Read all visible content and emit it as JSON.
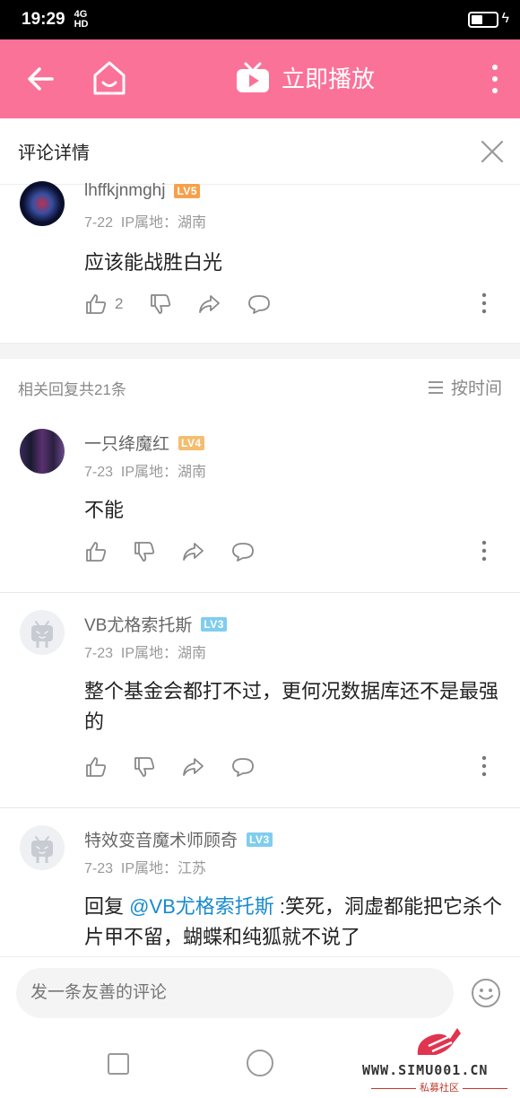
{
  "status_bar": {
    "time": "19:29",
    "network": "4G",
    "hd": "HD"
  },
  "app_bar": {
    "play_label": "立即播放"
  },
  "header": {
    "title": "评论详情"
  },
  "main_comment": {
    "user": "lhffkjnmghj",
    "level": "LV5",
    "level_color": "#f7a04a",
    "date": "7-22",
    "ip": "IP属地：湖南",
    "content": "应该能战胜白光",
    "likes": "2"
  },
  "replies_header": {
    "count_label": "相关回复共21条",
    "sort_label": "按时间"
  },
  "replies": [
    {
      "user": "一只绛魔红",
      "level": "LV4",
      "level_color": "#f5bd70",
      "date": "7-23",
      "ip": "IP属地：湖南",
      "content": "不能"
    },
    {
      "user": "VB尤格索托斯",
      "level": "LV3",
      "level_color": "#7fcdef",
      "date": "7-23",
      "ip": "IP属地：湖南",
      "content": "整个基金会都打不过，更何况数据库还不是最强的"
    },
    {
      "user": "特效变音魔术师顾奇",
      "level": "LV3",
      "level_color": "#7fcdef",
      "date": "7-23",
      "ip": "IP属地：江苏",
      "content_prefix": "回复 ",
      "mention": "@VB尤格索托斯",
      "content": " :笑死，洞虚都能把它杀个片甲不留，蝴蝶和纯狐就不说了"
    }
  ],
  "input": {
    "placeholder": "发一条友善的评论"
  },
  "watermark": {
    "site": "WWW.SIMU001.CN",
    "sub": "私募社区"
  },
  "colors": {
    "brand_pink": "#fb7299",
    "mention_blue": "#178bcf"
  }
}
